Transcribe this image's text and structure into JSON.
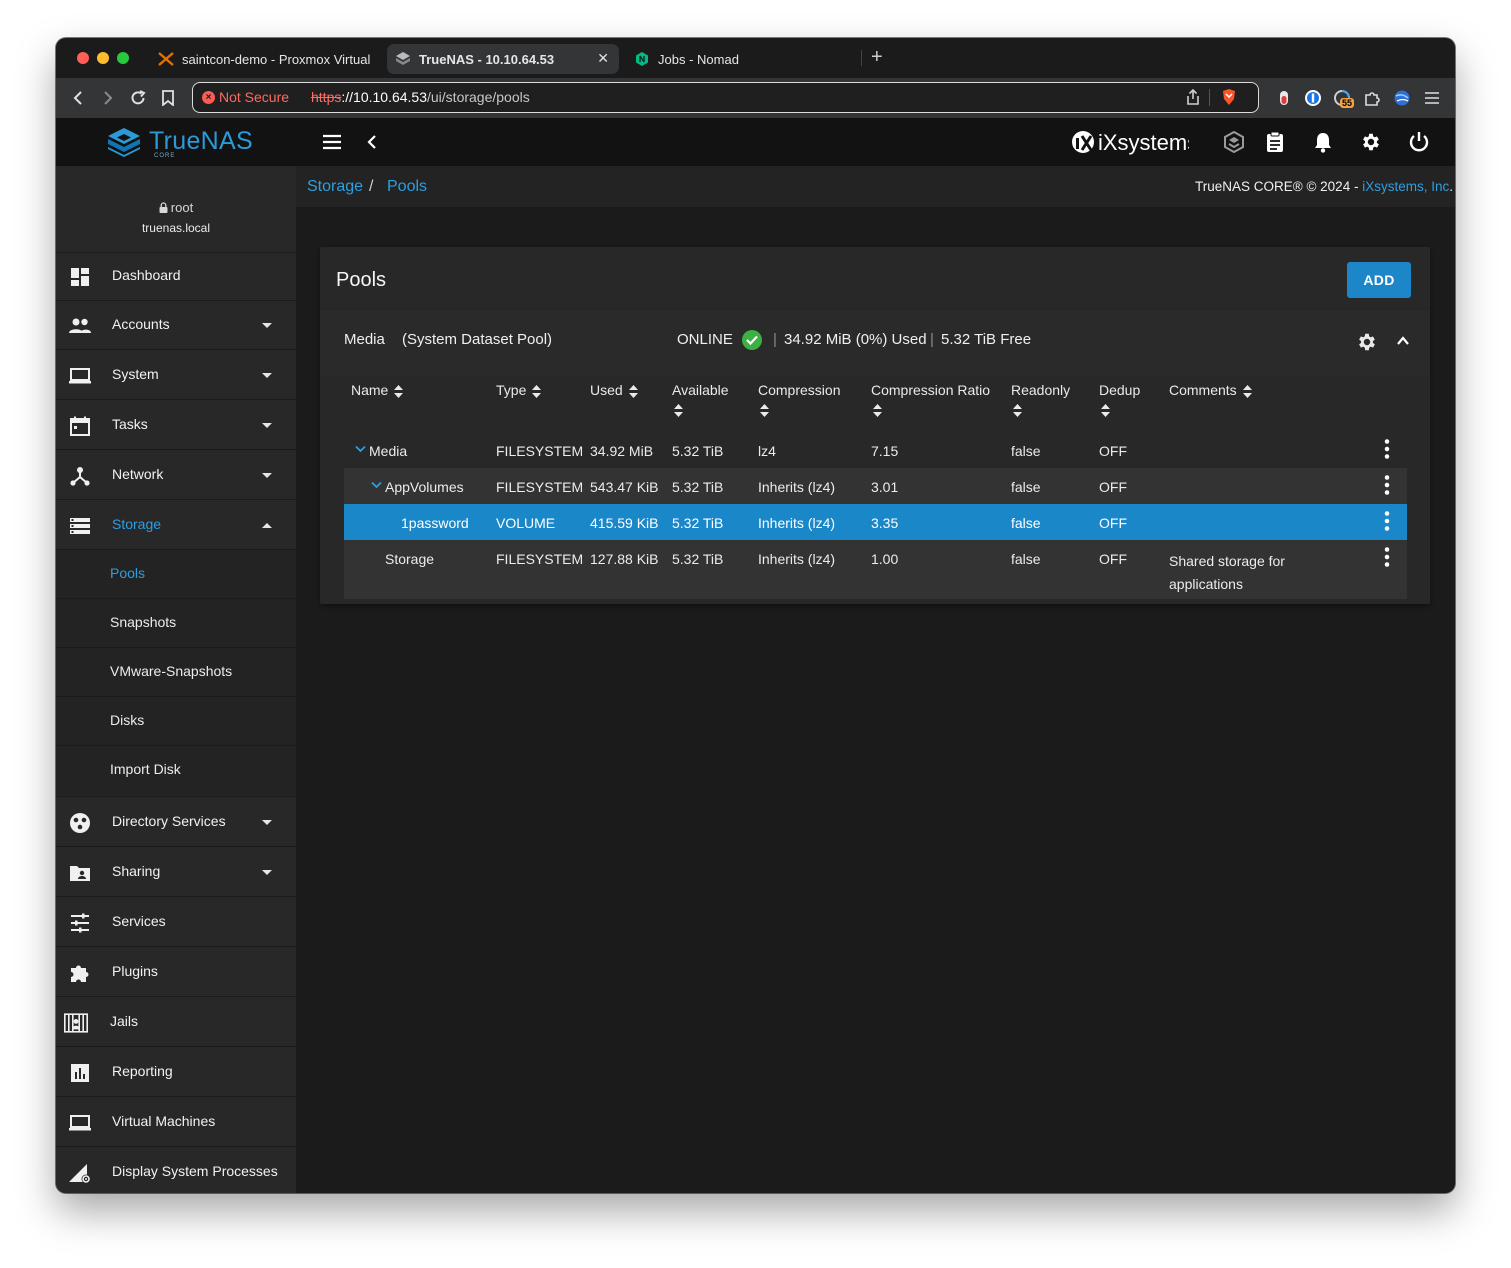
{
  "browser": {
    "tabs": [
      {
        "label": "saintcon-demo - Proxmox Virtual",
        "icon": "proxmox-icon"
      },
      {
        "label": "TrueNAS - 10.10.64.53",
        "icon": "truenas-icon",
        "active": true
      },
      {
        "label": "Jobs - Nomad",
        "icon": "nomad-icon"
      }
    ],
    "not_secure": "Not Secure",
    "url_scheme": "https",
    "url_host": "://10.10.64.53",
    "url_path": "/ui/storage/pools",
    "extension_badge": "55"
  },
  "header": {
    "brand": "TrueNAS",
    "brand_sub": "CORE",
    "vendor_logo": "iXsystems"
  },
  "user": {
    "name": "root",
    "host": "truenas.local"
  },
  "sidebar": {
    "items": [
      {
        "label": "Dashboard",
        "icon": "dashboard-icon"
      },
      {
        "label": "Accounts",
        "icon": "accounts-icon"
      },
      {
        "label": "System",
        "icon": "laptop-icon"
      },
      {
        "label": "Tasks",
        "icon": "calendar-icon"
      },
      {
        "label": "Network",
        "icon": "network-icon"
      },
      {
        "label": "Storage",
        "icon": "storage-icon"
      },
      {
        "label": "Directory Services",
        "icon": "directory-icon"
      },
      {
        "label": "Sharing",
        "icon": "folder-share-icon"
      },
      {
        "label": "Services",
        "icon": "tune-icon"
      },
      {
        "label": "Plugins",
        "icon": "puzzle-icon"
      },
      {
        "label": "Jails",
        "icon": "jail-icon"
      },
      {
        "label": "Reporting",
        "icon": "chart-icon"
      },
      {
        "label": "Virtual Machines",
        "icon": "laptop-icon"
      },
      {
        "label": "Display System Processes",
        "icon": "processes-icon"
      }
    ],
    "storage_sub": [
      "Pools",
      "Snapshots",
      "VMware-Snapshots",
      "Disks",
      "Import Disk"
    ]
  },
  "breadcrumb": {
    "section": "Storage",
    "separator": "/",
    "page": "Pools"
  },
  "copyright": {
    "text": "TrueNAS CORE® © 2024 - ",
    "link": "iXsystems, Inc",
    "end": "."
  },
  "pools_card": {
    "title": "Pools",
    "add_label": "ADD",
    "pool_name": "Media",
    "pool_desc": "(System Dataset Pool)",
    "status": "ONLINE",
    "sep": "|",
    "used": "34.92 MiB (0%) Used",
    "free": "5.32 TiB Free"
  },
  "table": {
    "columns": [
      "Name",
      "Type",
      "Used",
      "Available",
      "Compression",
      "Compression Ratio",
      "Readonly",
      "Dedup",
      "Comments"
    ],
    "rows": [
      {
        "name": "Media",
        "type": "FILESYSTEM",
        "used": "34.92 MiB",
        "available": "5.32 TiB",
        "compression": "lz4",
        "ratio": "7.15",
        "readonly": "false",
        "dedup": "OFF",
        "comments": ""
      },
      {
        "name": "AppVolumes",
        "type": "FILESYSTEM",
        "used": "543.47 KiB",
        "available": "5.32 TiB",
        "compression": "Inherits (lz4)",
        "ratio": "3.01",
        "readonly": "false",
        "dedup": "OFF",
        "comments": ""
      },
      {
        "name": "1password",
        "type": "VOLUME",
        "used": "415.59 KiB",
        "available": "5.32 TiB",
        "compression": "Inherits (lz4)",
        "ratio": "3.35",
        "readonly": "false",
        "dedup": "OFF",
        "comments": ""
      },
      {
        "name": "Storage",
        "type": "FILESYSTEM",
        "used": "127.88 KiB",
        "available": "5.32 TiB",
        "compression": "Inherits (lz4)",
        "ratio": "1.00",
        "readonly": "false",
        "dedup": "OFF",
        "comments": "Shared storage for applications"
      }
    ]
  },
  "colors": {
    "accent": "#2d9ee0",
    "selected_row": "#1a87c9",
    "online": "#3cb043"
  }
}
